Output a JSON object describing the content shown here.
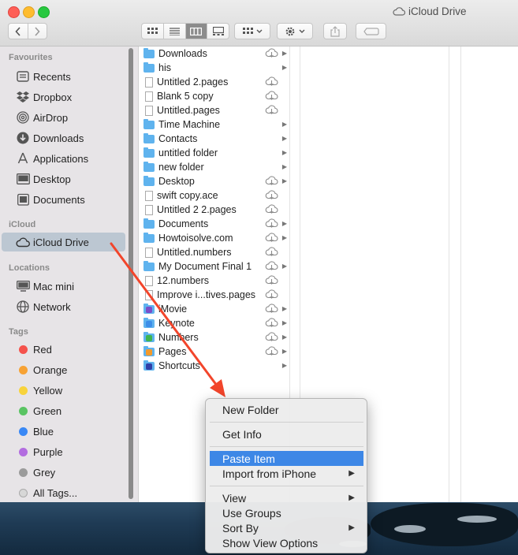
{
  "window": {
    "title": "iCloud Drive"
  },
  "toolbar": {
    "back_icon": "chevron-left",
    "forward_icon": "chevron-right",
    "view_modes": [
      "icon-view",
      "list-view",
      "column-view",
      "gallery-view"
    ],
    "active_view": "column-view"
  },
  "sidebar": {
    "favourites_heading": "Favourites",
    "favourites": [
      {
        "label": "Recents",
        "icon": "clock-icon"
      },
      {
        "label": "Dropbox",
        "icon": "dropbox-icon"
      },
      {
        "label": "AirDrop",
        "icon": "airdrop-icon"
      },
      {
        "label": "Downloads",
        "icon": "download-icon"
      },
      {
        "label": "Applications",
        "icon": "applications-icon"
      },
      {
        "label": "Desktop",
        "icon": "desktop-icon"
      },
      {
        "label": "Documents",
        "icon": "documents-icon"
      }
    ],
    "icloud_heading": "iCloud",
    "icloud_items": [
      {
        "label": "iCloud Drive",
        "icon": "cloud-icon",
        "selected": true
      }
    ],
    "locations_heading": "Locations",
    "locations": [
      {
        "label": "Mac mini",
        "icon": "computer-icon"
      },
      {
        "label": "Network",
        "icon": "globe-icon"
      }
    ],
    "tags_heading": "Tags",
    "tags": [
      {
        "label": "Red",
        "color": "#f5524c"
      },
      {
        "label": "Orange",
        "color": "#f7a234"
      },
      {
        "label": "Yellow",
        "color": "#f8d33c"
      },
      {
        "label": "Green",
        "color": "#5ac463"
      },
      {
        "label": "Blue",
        "color": "#3a88f5"
      },
      {
        "label": "Purple",
        "color": "#b36de0"
      },
      {
        "label": "Grey",
        "color": "#9b9b9b"
      },
      {
        "label": "All Tags...",
        "color": "#d7d7d7"
      }
    ]
  },
  "files": [
    {
      "name": "Downloads",
      "kind": "folder",
      "cloud": true,
      "arrow": true
    },
    {
      "name": "his",
      "kind": "folder",
      "cloud": false,
      "arrow": true
    },
    {
      "name": "Untitled 2.pages",
      "kind": "doc",
      "cloud": true,
      "arrow": false
    },
    {
      "name": "Blank 5 copy",
      "kind": "doc",
      "cloud": true,
      "arrow": false
    },
    {
      "name": "Untitled.pages",
      "kind": "doc",
      "cloud": true,
      "arrow": false
    },
    {
      "name": "Time Machine",
      "kind": "folder",
      "cloud": false,
      "arrow": true
    },
    {
      "name": "Contacts",
      "kind": "folder",
      "cloud": false,
      "arrow": true
    },
    {
      "name": "untitled folder",
      "kind": "folder",
      "cloud": false,
      "arrow": true
    },
    {
      "name": "new folder",
      "kind": "folder",
      "cloud": false,
      "arrow": true
    },
    {
      "name": "Desktop",
      "kind": "folder",
      "cloud": true,
      "arrow": true
    },
    {
      "name": "swift copy.ace",
      "kind": "doc",
      "cloud": true,
      "arrow": false
    },
    {
      "name": "Untitled 2 2.pages",
      "kind": "doc",
      "cloud": true,
      "arrow": false
    },
    {
      "name": "Documents",
      "kind": "folder",
      "cloud": true,
      "arrow": true
    },
    {
      "name": "Howtoisolve.com",
      "kind": "folder",
      "cloud": true,
      "arrow": true
    },
    {
      "name": "Untitled.numbers",
      "kind": "doc",
      "cloud": true,
      "arrow": false
    },
    {
      "name": "My Document Final 1",
      "kind": "folder",
      "cloud": true,
      "arrow": true
    },
    {
      "name": "12.numbers",
      "kind": "doc",
      "cloud": true,
      "arrow": false
    },
    {
      "name": "Improve i...tives.pages",
      "kind": "doc",
      "cloud": true,
      "arrow": false
    },
    {
      "name": "iMovie",
      "kind": "app-imovie",
      "cloud": true,
      "arrow": true
    },
    {
      "name": "Keynote",
      "kind": "app-keynote",
      "cloud": true,
      "arrow": true
    },
    {
      "name": "Numbers",
      "kind": "app-numbers",
      "cloud": true,
      "arrow": true
    },
    {
      "name": "Pages",
      "kind": "app-pages",
      "cloud": true,
      "arrow": true
    },
    {
      "name": "Shortcuts",
      "kind": "app-shortcuts",
      "cloud": false,
      "arrow": true
    }
  ],
  "context_menu": {
    "new_folder": "New Folder",
    "get_info": "Get Info",
    "paste_item": "Paste Item",
    "import_from_iphone": "Import from iPhone",
    "view": "View",
    "use_groups": "Use Groups",
    "sort_by": "Sort By",
    "show_view_options": "Show View Options"
  },
  "annotation": {
    "arrow_color": "#f2452b"
  }
}
